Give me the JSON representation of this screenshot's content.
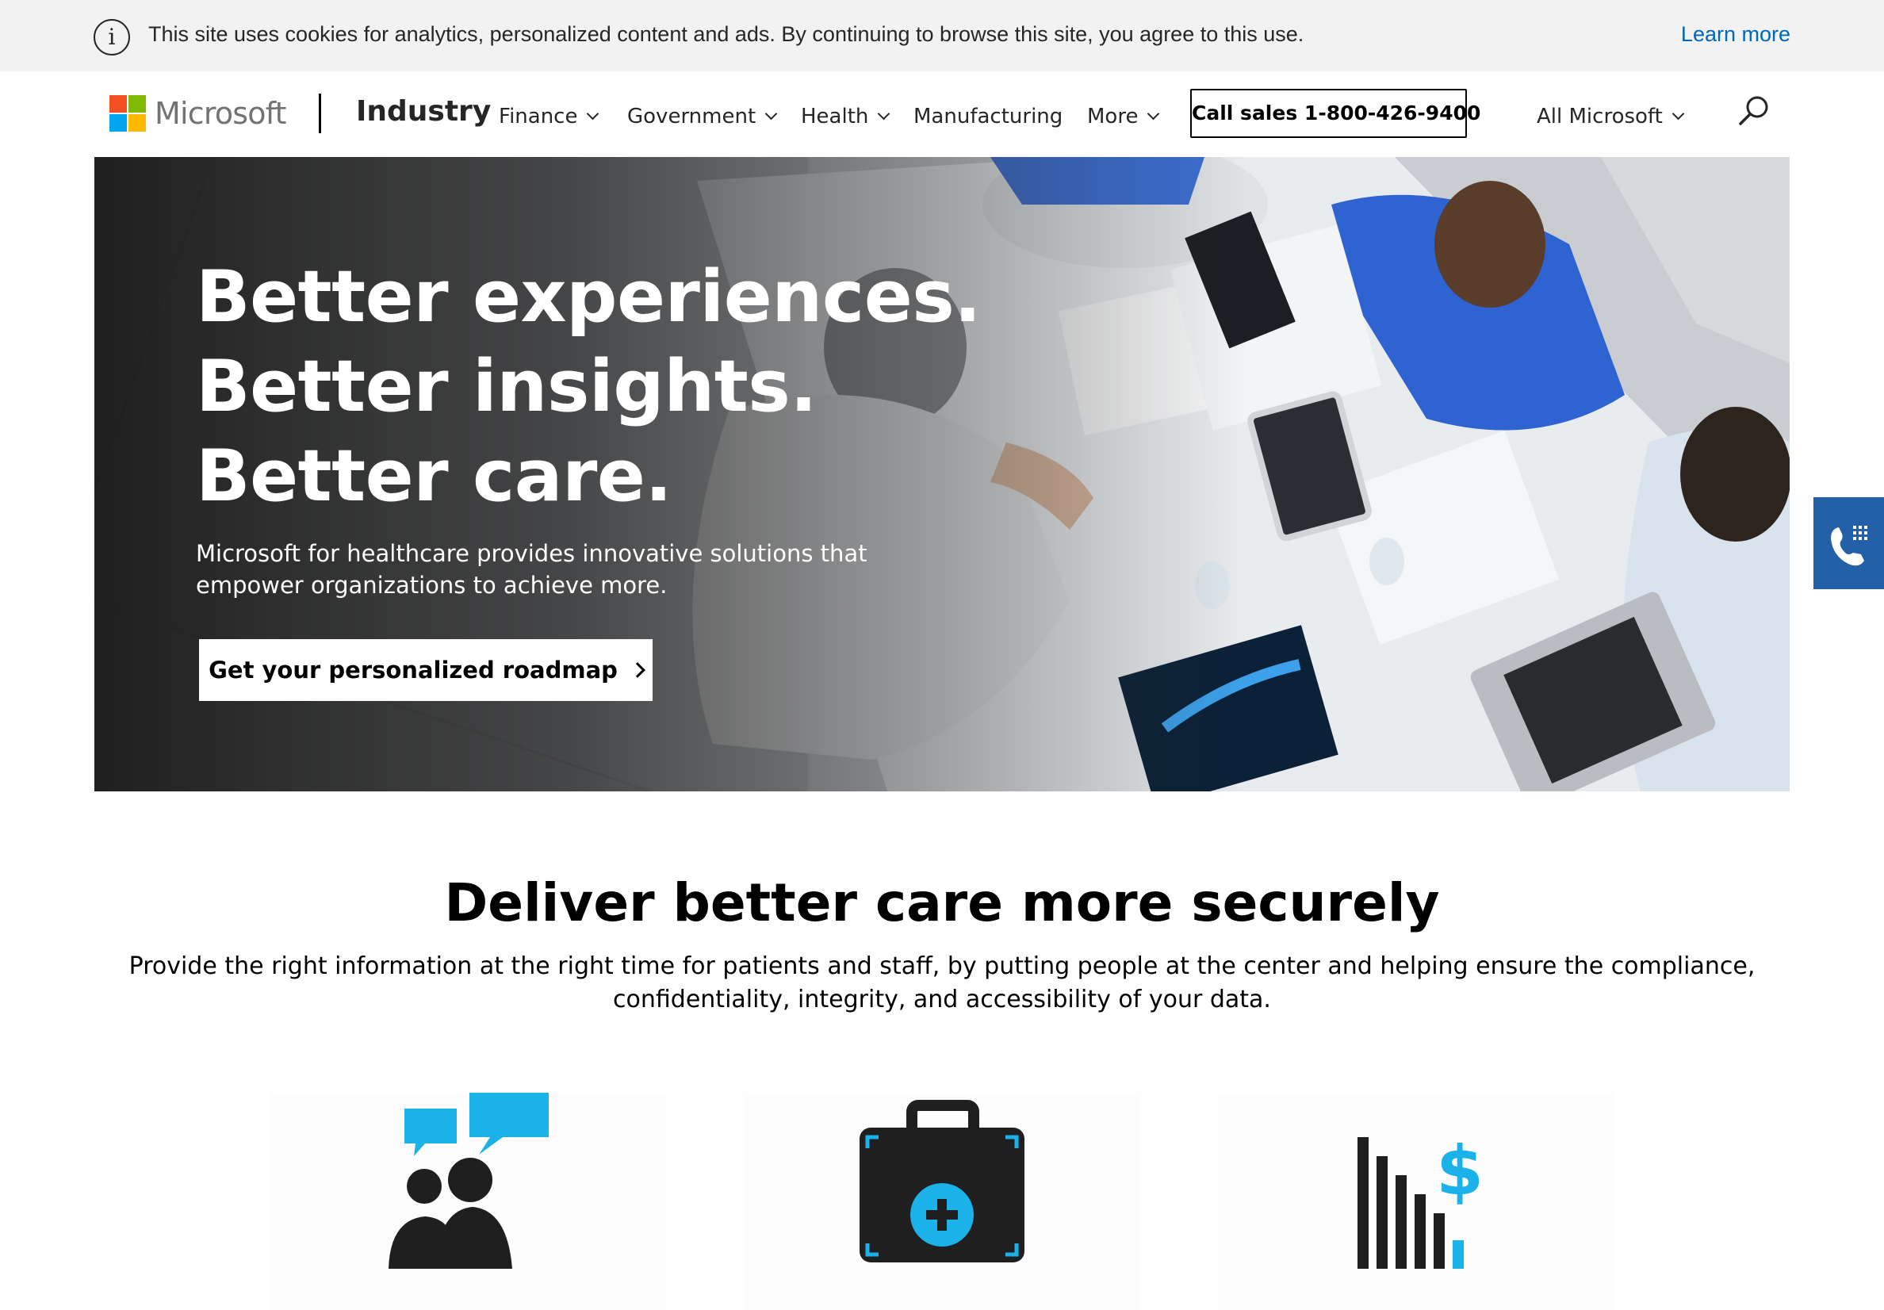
{
  "cookie_banner": {
    "icon": "info-icon",
    "text": "This site uses cookies for analytics, personalized content and ads. By continuing to browse this site, you agree to this use.",
    "link": "Learn more"
  },
  "header": {
    "brand": "Microsoft",
    "logo_colors": [
      "#f25022",
      "#7fba00",
      "#00a4ef",
      "#ffb900"
    ],
    "section": "Industry",
    "nav": [
      {
        "label": "Finance",
        "has_menu": true
      },
      {
        "label": "Government",
        "has_menu": true
      },
      {
        "label": "Health",
        "has_menu": true
      },
      {
        "label": "Manufacturing",
        "has_menu": false
      },
      {
        "label": "More",
        "has_menu": true
      }
    ],
    "call_button": "Call sales 1-800-426-9400",
    "all_microsoft": "All Microsoft",
    "search_icon": "search-icon"
  },
  "hero": {
    "title": "Better experiences. Better insights. Better care.",
    "subtitle": "Microsoft for healthcare provides innovative solutions that empower organizations to achieve more.",
    "cta": "Get your personalized roadmap"
  },
  "floating_contact": {
    "icon": "phone-dialpad-icon",
    "color": "#2360a8"
  },
  "section": {
    "title": "Deliver better care more securely",
    "description": "Provide the right information at the right time for patients and staff, by putting people at the center and helping ensure the compliance, confidentiality, integrity, and accessibility of your data."
  },
  "features": [
    {
      "icon": "people-conversation-icon"
    },
    {
      "icon": "medical-kit-icon"
    },
    {
      "icon": "bar-chart-dollar-icon"
    }
  ],
  "colors": {
    "accent": "#0067b8",
    "icon_blue": "#1ab2e8",
    "icon_dark": "#1f1f1f"
  }
}
